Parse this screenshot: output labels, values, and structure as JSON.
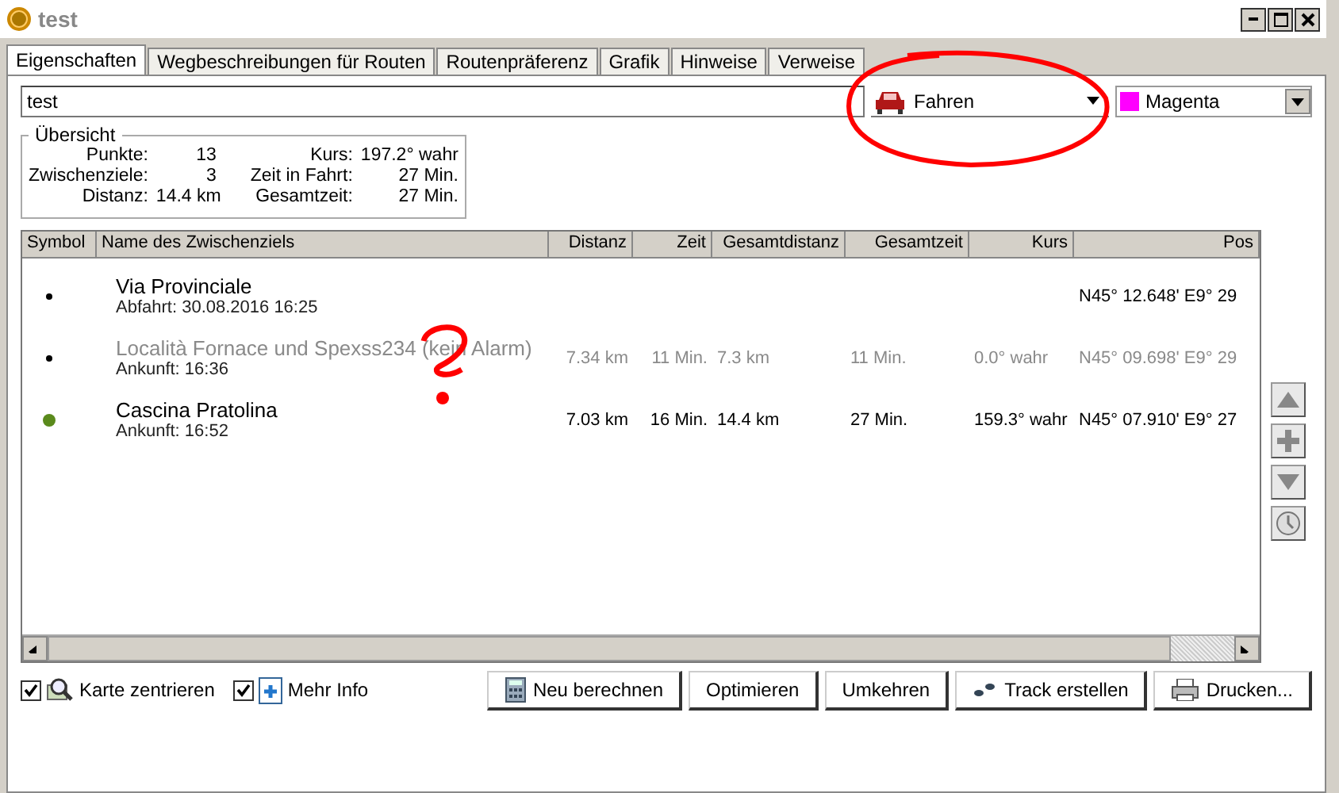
{
  "window": {
    "title": "test"
  },
  "tabs": [
    {
      "label": "Eigenschaften",
      "selected": true
    },
    {
      "label": "Wegbeschreibungen für Routen",
      "selected": false
    },
    {
      "label": "Routenpräferenz",
      "selected": false
    },
    {
      "label": "Grafik",
      "selected": false
    },
    {
      "label": "Hinweise",
      "selected": false
    },
    {
      "label": "Verweise",
      "selected": false
    }
  ],
  "name_field": {
    "value": "test"
  },
  "mode_dropdown": {
    "value": "Fahren"
  },
  "color_dropdown": {
    "value": "Magenta",
    "color": "#ff00ff"
  },
  "overview": {
    "title": "Übersicht",
    "left": [
      {
        "label": "Punkte:",
        "value": "13"
      },
      {
        "label": "Zwischenziele:",
        "value": "3"
      },
      {
        "label": "Distanz:",
        "value": "14.4 km"
      }
    ],
    "right": [
      {
        "label": "Kurs:",
        "value": "197.2° wahr"
      },
      {
        "label": "Zeit in Fahrt:",
        "value": "27 Min."
      },
      {
        "label": "Gesamtzeit:",
        "value": "27 Min."
      }
    ]
  },
  "table": {
    "columns": [
      "Symbol",
      "Name des Zwischenziels",
      "Distanz",
      "Zeit",
      "Gesamtdistanz",
      "Gesamtzeit",
      "Kurs",
      "Pos"
    ],
    "rows": [
      {
        "color": "#000000",
        "dimmed": false,
        "sub": "Abfahrt: 30.08.2016 16:25",
        "cells": [
          "",
          "Via Provinciale",
          "",
          "",
          "",
          "",
          "",
          "N45° 12.648' E9° 29"
        ]
      },
      {
        "color": "#000000",
        "dimmed": true,
        "sub": "Ankunft: 16:36",
        "cells": [
          "",
          "Località Fornace und  Spexss234 (kein Alarm)",
          "7.34 km",
          "11 Min.",
          "7.3 km",
          "11 Min.",
          "0.0° wahr",
          "N45° 09.698' E9° 29"
        ]
      },
      {
        "color": "#5a8a1c",
        "dimmed": false,
        "sub": "Ankunft: 16:52",
        "cells": [
          "",
          "Cascina Pratolina",
          "7.03 km",
          "16 Min.",
          "14.4 km",
          "27 Min.",
          "159.3° wahr",
          "N45° 07.910' E9° 27"
        ]
      }
    ]
  },
  "options": [
    {
      "label": "Karte zentrieren",
      "checked": true
    },
    {
      "label": "Mehr Info",
      "checked": true
    }
  ],
  "buttons": [
    {
      "label": "Neu berechnen",
      "kind": "calc"
    },
    {
      "label": "Optimieren",
      "kind": "plain"
    },
    {
      "label": "Umkehren",
      "kind": "plain"
    },
    {
      "label": "Track erstellen",
      "kind": "track"
    },
    {
      "label": "Drucken...",
      "kind": "print"
    }
  ]
}
